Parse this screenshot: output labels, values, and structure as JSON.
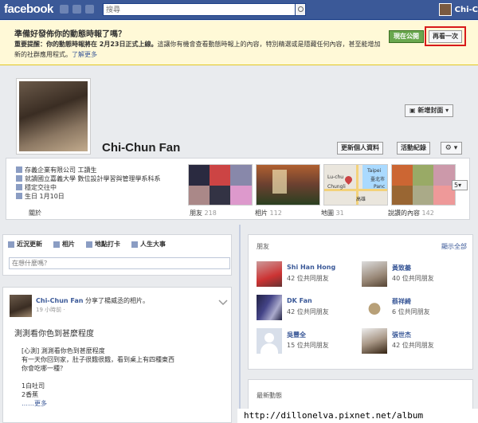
{
  "topbar": {
    "logo": "facebook",
    "search_placeholder": "搜尋",
    "user_name": "Chi-C"
  },
  "banner": {
    "title": "準備好發佈你的動態時報了嗎？",
    "bold_text": "重要提醒：你的動態時報將在 2月23日正式上線。",
    "body_text": "這讓你有機會查看動態時報上的內容，特別精選或是隱藏任何內容，甚至能增加新的社群應用程式。",
    "learn_more": "了解更多",
    "publish_label": "現在公開",
    "again_label": "再看一次"
  },
  "cover": {
    "new_cover_label": "新增封面"
  },
  "profile": {
    "name": "Chi-Chun Fan",
    "update_info_label": "更新個人資料",
    "activity_log_label": "活動紀錄",
    "gear_label": "⚙ ▾",
    "about": [
      "存義企業有限公司 工讀生",
      "就讀國立嘉義大學 數位設計學習與管理學系科系",
      "穩定交往中",
      "生日 1月10日"
    ],
    "about_label": "關於"
  },
  "tiles": [
    {
      "label": "朋友",
      "count": "218"
    },
    {
      "label": "相片",
      "count": "112"
    },
    {
      "label": "地圖",
      "count": "31"
    },
    {
      "label": "說讚的內容",
      "count": "142"
    }
  ],
  "map_labels": [
    "Lu-chu",
    "Taipei",
    "臺北市",
    "Chungli",
    "Panc",
    "高雄"
  ],
  "more_dropdown": "5▾",
  "composer": {
    "tabs": [
      "近況更新",
      "相片",
      "地點打卡",
      "人生大事"
    ],
    "placeholder": "在想什麼嗎？"
  },
  "post": {
    "author": "Chi-Chun Fan",
    "action": " 分享了楊威丞的相片。",
    "time": "19 小時前 ·",
    "caption": "測測看你色到甚麼程度",
    "body_lines": [
      "[心測] 測測看你色到甚麼程度",
      "有一天你回到家，肚子很餓很餓，看到桌上有四種東西",
      "你會吃哪一種？",
      "",
      "1白吐司",
      "2香蕉"
    ],
    "more_label": "……更多"
  },
  "friends": {
    "title": "朋友",
    "see_all": "顯示全部",
    "items": [
      {
        "name": "Shi Han Hong",
        "count": "42 位共同朋友"
      },
      {
        "name": "黃致蓁",
        "count": "40 位共同朋友"
      },
      {
        "name": "DK Fan",
        "count": "42 位共同朋友"
      },
      {
        "name": "蔡祥綺",
        "count": "6 位共同朋友"
      },
      {
        "name": "吳豐全",
        "count": "15 位共同朋友"
      },
      {
        "name": "張世杰",
        "count": "42 位共同朋友"
      }
    ]
  },
  "recent": {
    "title": "最新動態"
  },
  "watermark": "http://dillonelva.pixnet.net/album"
}
